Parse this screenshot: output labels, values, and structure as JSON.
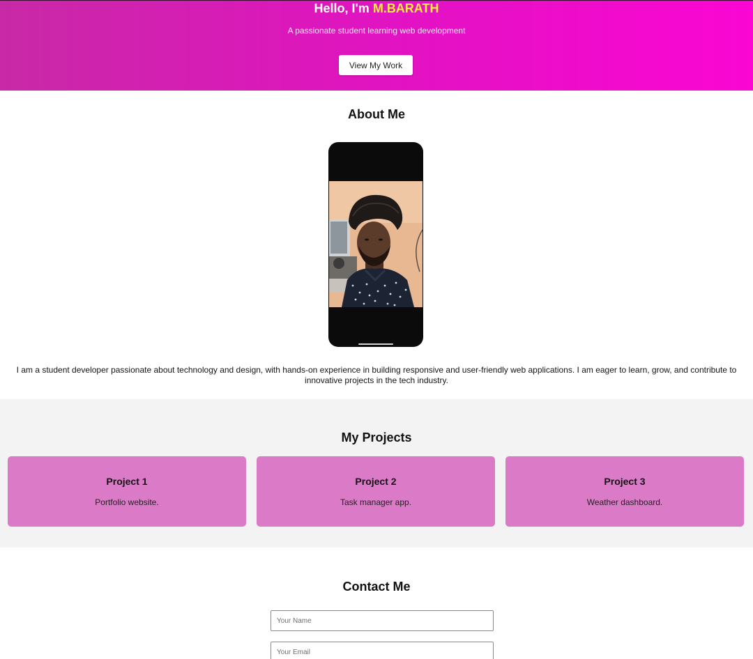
{
  "hero": {
    "greeting": "Hello, I'm ",
    "name": "M.BARATH",
    "subtitle": "A passionate student learning web development",
    "button_label": "View My Work"
  },
  "about": {
    "title": "About Me",
    "text": "I am a student developer passionate about technology and design, with hands-on experience in building responsive and user-friendly web applications. I am eager to learn, grow, and contribute to innovative projects in the tech industry."
  },
  "projects": {
    "title": "My Projects",
    "items": [
      {
        "title": "Project 1",
        "desc": "Portfolio website."
      },
      {
        "title": "Project 2",
        "desc": "Task manager app."
      },
      {
        "title": "Project 3",
        "desc": "Weather dashboard."
      }
    ]
  },
  "contact": {
    "title": "Contact Me",
    "name_placeholder": "Your Name",
    "email_placeholder": "Your Email"
  },
  "colors": {
    "hero_gradient_start": "#c829a6",
    "hero_gradient_end": "#fb06d3",
    "name_highlight": "#ffeb3b",
    "card_bg": "#db7bc8",
    "projects_bg": "#f3f3f3"
  }
}
